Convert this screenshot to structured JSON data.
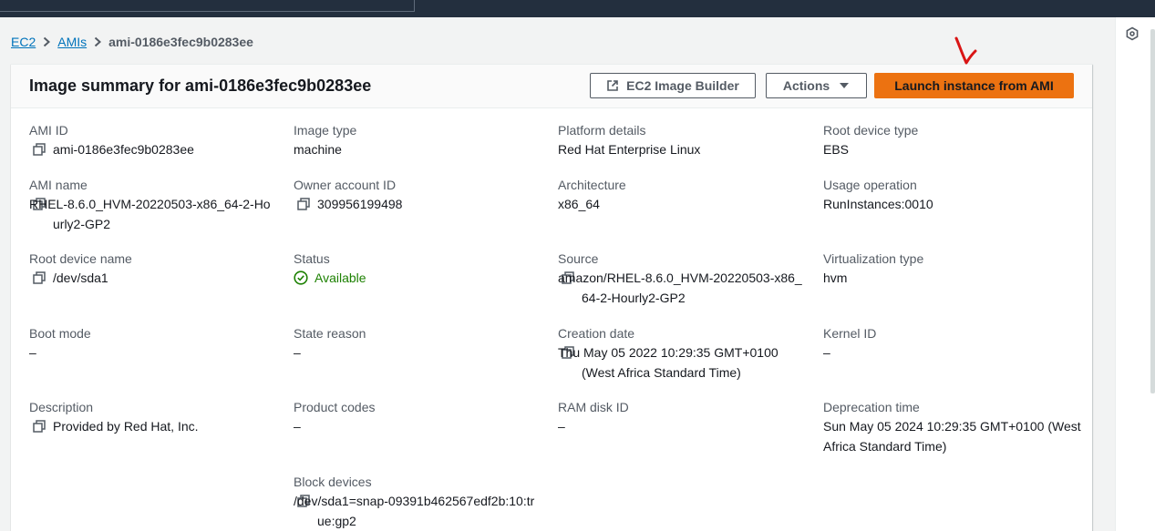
{
  "breadcrumb": {
    "items": [
      {
        "label": "EC2"
      },
      {
        "label": "AMIs"
      }
    ],
    "current": "ami-0186e3fec9b0283ee"
  },
  "panel": {
    "title": "Image summary for ami-0186e3fec9b0283ee",
    "buttons": {
      "image_builder": "EC2 Image Builder",
      "actions": "Actions",
      "launch": "Launch instance from AMI"
    }
  },
  "fields": {
    "ami_id": {
      "label": "AMI ID",
      "value": "ami-0186e3fec9b0283ee"
    },
    "image_type": {
      "label": "Image type",
      "value": "machine"
    },
    "platform_details": {
      "label": "Platform details",
      "value": "Red Hat Enterprise Linux"
    },
    "root_device_type": {
      "label": "Root device type",
      "value": "EBS"
    },
    "ami_name": {
      "label": "AMI name",
      "value": "RHEL-8.6.0_HVM-20220503-x86_64-2-Hourly2-GP2"
    },
    "owner_account_id": {
      "label": "Owner account ID",
      "value": "309956199498"
    },
    "architecture": {
      "label": "Architecture",
      "value": "x86_64"
    },
    "usage_operation": {
      "label": "Usage operation",
      "value": "RunInstances:0010"
    },
    "root_device_name": {
      "label": "Root device name",
      "value": "/dev/sda1"
    },
    "status": {
      "label": "Status",
      "value": "Available"
    },
    "source": {
      "label": "Source",
      "value": "amazon/RHEL-8.6.0_HVM-20220503-x86_64-2-Hourly2-GP2"
    },
    "virtualization_type": {
      "label": "Virtualization type",
      "value": "hvm"
    },
    "boot_mode": {
      "label": "Boot mode",
      "value": "–"
    },
    "state_reason": {
      "label": "State reason",
      "value": "–"
    },
    "creation_date": {
      "label": "Creation date",
      "value": "Thu May 05 2022 10:29:35 GMT+0100 (West Africa Standard Time)"
    },
    "kernel_id": {
      "label": "Kernel ID",
      "value": "–"
    },
    "description": {
      "label": "Description",
      "value": "Provided by Red Hat, Inc."
    },
    "product_codes": {
      "label": "Product codes",
      "value": "–"
    },
    "ram_disk_id": {
      "label": "RAM disk ID",
      "value": "–"
    },
    "deprecation_time": {
      "label": "Deprecation time",
      "value": "Sun May 05 2024 10:29:35 GMT+0100 (West Africa Standard Time)"
    },
    "block_devices": {
      "label": "Block devices",
      "value": "/dev/sda1=snap-09391b462567edf2b:10:true:gp2"
    }
  },
  "icons": {
    "copy": "copy-icon",
    "external": "external-link-icon",
    "status_ok": "check-circle-icon",
    "caret": "caret-down-icon",
    "rail": "hexagon-icon",
    "chevron": "chevron-right-icon"
  },
  "colors": {
    "link": "#0073bb",
    "primary": "#ec7211",
    "success": "#1d8102",
    "topbar": "#232f3e",
    "annotation": "#d91515"
  }
}
